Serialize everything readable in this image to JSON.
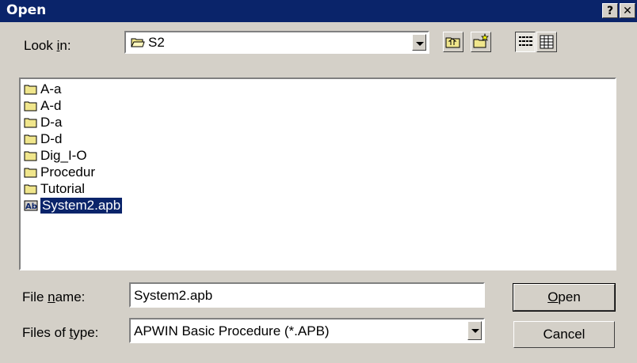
{
  "window": {
    "title": "Open",
    "help_label": "?",
    "close_label": "✕"
  },
  "look_in": {
    "label_pre": "Look ",
    "label_key": "i",
    "label_post": "n:",
    "value": "S2",
    "folder_icon": "folder-open-icon"
  },
  "toolbar": {
    "up_icon": "up-one-level-icon",
    "new_folder_icon": "create-new-folder-icon",
    "list_icon": "list-view-icon",
    "details_icon": "details-view-icon"
  },
  "files": [
    {
      "name": "A-a",
      "type": "folder"
    },
    {
      "name": "A-d",
      "type": "folder"
    },
    {
      "name": "D-a",
      "type": "folder"
    },
    {
      "name": "D-d",
      "type": "folder"
    },
    {
      "name": "Dig_I-O",
      "type": "folder"
    },
    {
      "name": "Procedur",
      "type": "folder"
    },
    {
      "name": "Tutorial",
      "type": "folder"
    },
    {
      "name": "System2.apb",
      "type": "apb-file",
      "selected": true
    }
  ],
  "file_name": {
    "label_pre": "File ",
    "label_key": "n",
    "label_post": "ame:",
    "value": "System2.apb"
  },
  "file_type": {
    "label_pre": "Files of ",
    "label_key": "t",
    "label_post": "ype:",
    "value": "APWIN Basic Procedure (*.APB)"
  },
  "buttons": {
    "open_key": "O",
    "open_rest": "pen",
    "cancel": "Cancel"
  },
  "colors": {
    "titlebar": "#0a246a",
    "face": "#d4d0c8",
    "selection": "#0a246a",
    "folder": "#f0e68c"
  }
}
